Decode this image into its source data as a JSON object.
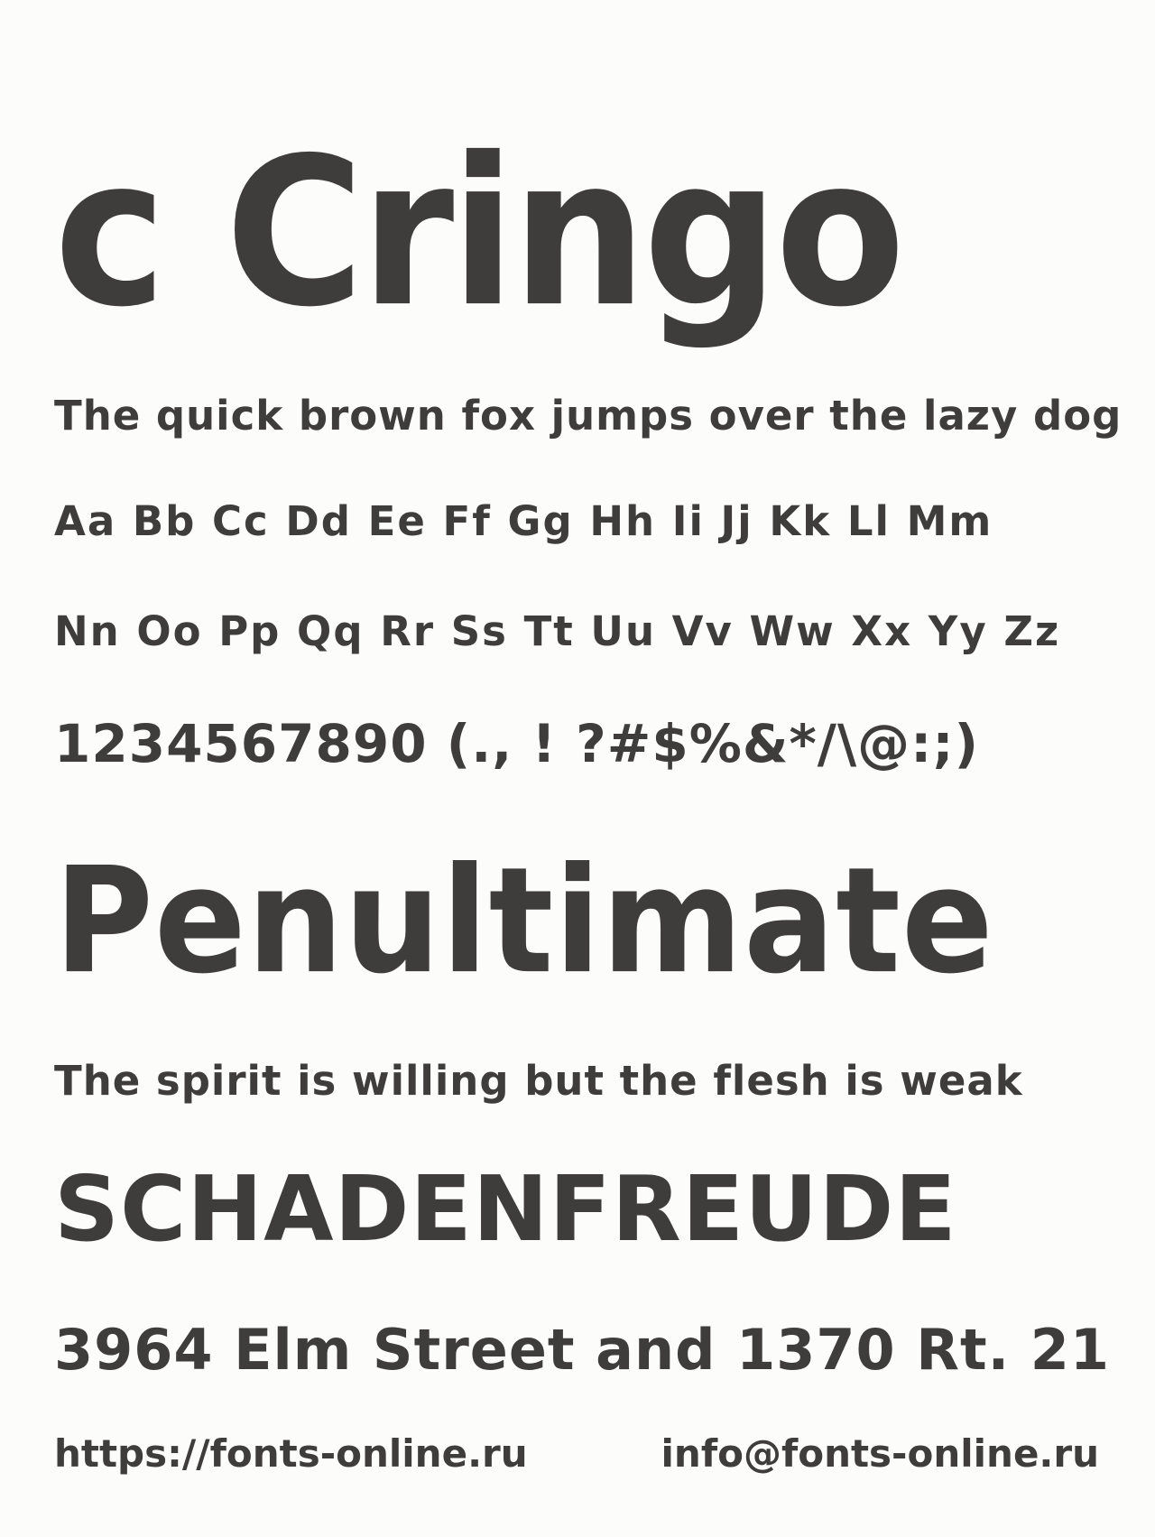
{
  "page": {
    "title": "c Cringo",
    "lines": [
      "The quick brown fox jumps over the lazy dog",
      "Aa Bb Cc Dd Ee Ff Gg Hh Ii Jj Kk Ll Mm",
      "Nn Oo Pp Qq Rr Ss Tt Uu Vv Ww Xx Yy Zz",
      "1234567890 (., ! ?#$%&*/\\@:;)",
      "Penultimate",
      "The spirit is willing but the flesh is weak",
      "SCHADENFREUDE",
      "3964 Elm Street and 1370 Rt. 21"
    ],
    "footer": {
      "left": "https://fonts-online.ru",
      "right": "info@fonts-online.ru"
    }
  },
  "colors": {
    "background": "#fcfcfb",
    "text": "#3e3d3b"
  }
}
